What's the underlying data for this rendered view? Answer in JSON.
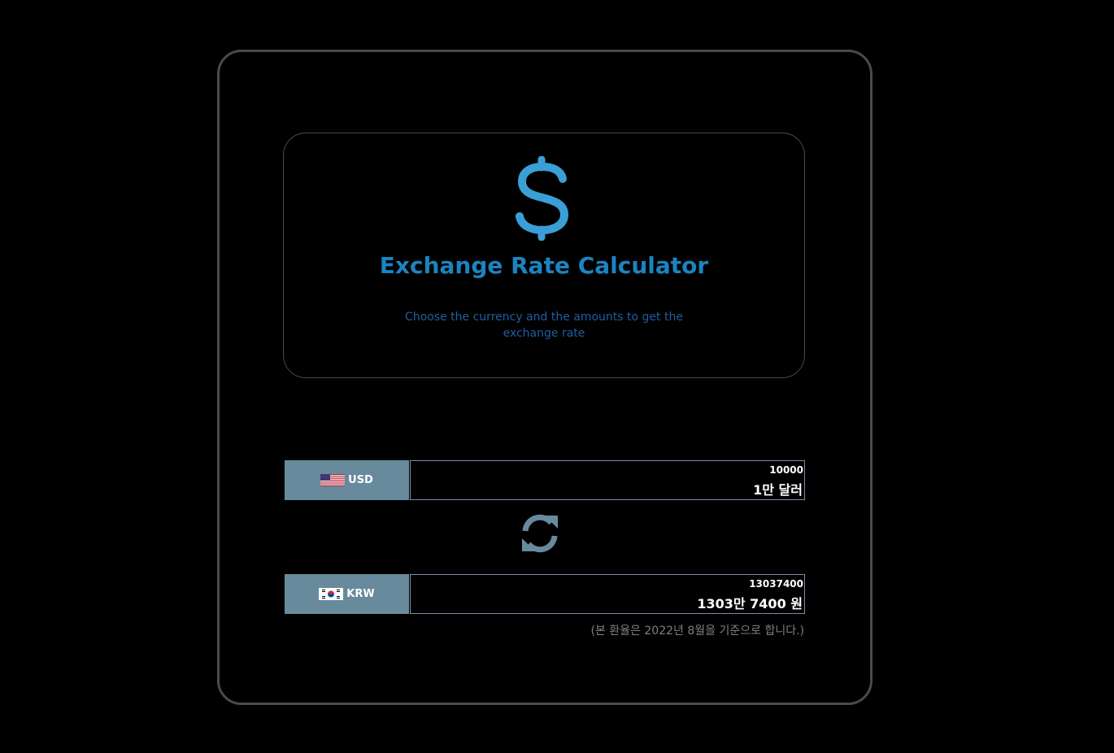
{
  "header": {
    "icon": "dollar-icon",
    "title": "Exchange Rate Calculator",
    "subtitle": "Choose the currency and the amounts to get the exchange rate"
  },
  "from": {
    "flag": "us-flag-icon",
    "currency": "USD",
    "amount": "10000",
    "amount_korean": "1만 달러"
  },
  "swap": {
    "icon": "swap-arrows-icon"
  },
  "to": {
    "flag": "kr-flag-icon",
    "currency": "KRW",
    "amount": "13037400",
    "amount_korean": "1303만 7400 원"
  },
  "note": "(본 환율은 2022년 8월을 기준으로 합니다.)",
  "colors": {
    "background": "#000000",
    "accent": "#1b84bf",
    "subtitle": "#1d5fa3",
    "select_bg": "#688a9d",
    "frame_border": "#4a4a4a",
    "input_border": "#7d8aa8",
    "note": "#7f7f7f"
  }
}
